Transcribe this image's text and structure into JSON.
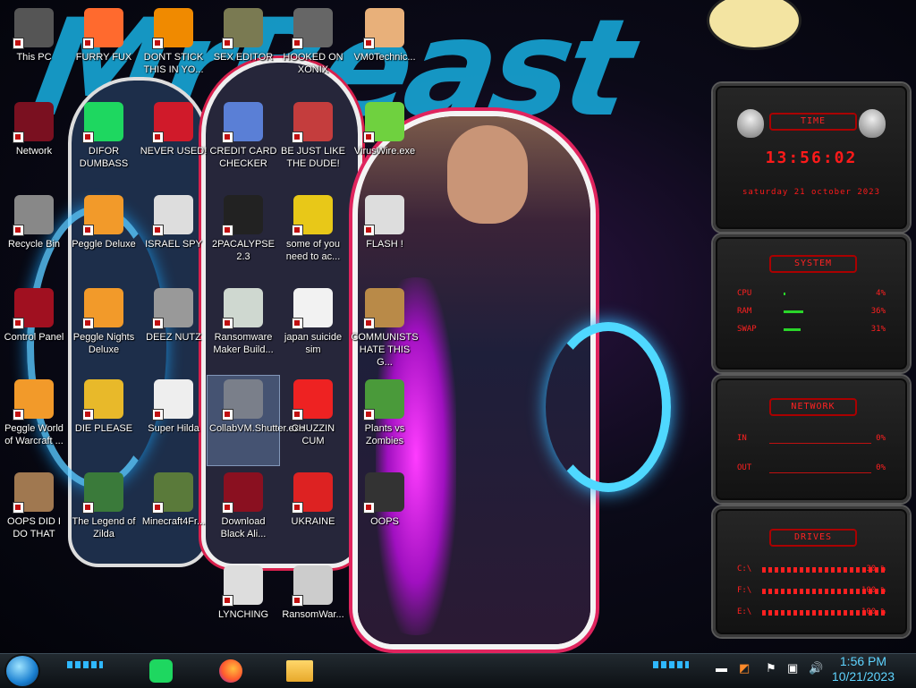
{
  "desktop": {
    "icons": [
      {
        "label": "This PC",
        "icon": "computer-icon"
      },
      {
        "label": "FURRY FUX",
        "icon": "firefox-icon"
      },
      {
        "label": "DONT STICK THIS IN YO...",
        "icon": "vlc-icon"
      },
      {
        "label": "SEX EDITOR",
        "icon": "hxd-icon"
      },
      {
        "label": "HOOKED ON XONIX",
        "icon": "xonix-icon"
      },
      {
        "label": "VM0Technic...",
        "icon": "doctor-icon"
      },
      {
        "label": "Network",
        "icon": "network-icon"
      },
      {
        "label": "DIFOR DUMBASS",
        "icon": "discord-icon"
      },
      {
        "label": "NEVER USED!",
        "icon": "dev-icon"
      },
      {
        "label": "CREDIT CARD CHECKER",
        "icon": "credit-card-icon"
      },
      {
        "label": "BE JUST LIKE THE DUDE!",
        "icon": "santa-icon"
      },
      {
        "label": "VirusWire.exe",
        "icon": "lime-icon"
      },
      {
        "label": "Recycle Bin",
        "icon": "recycle-bin-icon"
      },
      {
        "label": "Peggle Deluxe",
        "icon": "peggle-icon"
      },
      {
        "label": "ISRAEL SPY",
        "icon": "spy-icon"
      },
      {
        "label": "2PACALYPSE 2.3",
        "icon": "terminal-icon"
      },
      {
        "label": "some of you need to ac...",
        "icon": "beaver-icon"
      },
      {
        "label": "FLASH !",
        "icon": "flash-icon"
      },
      {
        "label": "Control Panel",
        "icon": "control-panel-icon"
      },
      {
        "label": "Peggle Nights Deluxe",
        "icon": "peggle-nights-icon"
      },
      {
        "label": "DEEZ NUTZ",
        "icon": "windows-stack-icon"
      },
      {
        "label": "Ransomware Maker Build...",
        "icon": "app-window-icon"
      },
      {
        "label": "japan suicide sim",
        "icon": "document-icon"
      },
      {
        "label": "COMMUNISTS HATE THIS G...",
        "icon": "money-bag-icon"
      },
      {
        "label": "Peggle World of Warcraft ...",
        "icon": "peggle-wow-icon"
      },
      {
        "label": "DIE PLEASE",
        "icon": "dreamweaver-icon"
      },
      {
        "label": "Super Hilda",
        "icon": "pixel-icon"
      },
      {
        "label": "CollabVM.Shutter.exe",
        "icon": "monitor-icon"
      },
      {
        "label": "CHUZZIN CUM",
        "icon": "chuzzle-icon"
      },
      {
        "label": "Plants vs Zombies",
        "icon": "plant-icon"
      },
      {
        "label": "OOPS DID I DO THAT",
        "icon": "portrait-icon"
      },
      {
        "label": "The Legend of Zilda",
        "icon": "zelda-icon"
      },
      {
        "label": "Minecraft4Fr...",
        "icon": "minecraft-icon"
      },
      {
        "label": "Download Black Ali...",
        "icon": "alien-icon"
      },
      {
        "label": "UKRAINE",
        "icon": "radiation-icon"
      },
      {
        "label": "OOPS",
        "icon": "oops-icon"
      },
      {
        "label": "LYNCHING",
        "icon": "rope-icon"
      },
      {
        "label": "RansomWar...",
        "icon": "skull-icon"
      }
    ],
    "collabvm_label": "CollabVM.Sh"
  },
  "widgets": {
    "time": {
      "title": "TIME",
      "time": "13:56:02",
      "date": "saturday 21 october 2023"
    },
    "system": {
      "title": "SYSTEM",
      "rows": [
        {
          "key": "CPU",
          "value": "4%",
          "level": 0.04
        },
        {
          "key": "RAM",
          "value": "36%",
          "level": 0.36
        },
        {
          "key": "SWAP",
          "value": "31%",
          "level": 0.31
        }
      ]
    },
    "network": {
      "title": "NETWORK",
      "rows": [
        {
          "key": "IN",
          "value": "0%"
        },
        {
          "key": "OUT",
          "value": "0%"
        }
      ]
    },
    "drives": {
      "title": "DRIVES",
      "rows": [
        {
          "key": "C:\\",
          "value": "30 %"
        },
        {
          "key": "F:\\",
          "value": "100 %"
        },
        {
          "key": "E:\\",
          "value": "100 %"
        }
      ]
    }
  },
  "taskbar": {
    "apps": [
      {
        "name": "spotify-app",
        "icon": "spotify-icon"
      },
      {
        "name": "firefox-app",
        "icon": "firefox-icon"
      },
      {
        "name": "explorer-app",
        "icon": "folder-icon"
      }
    ],
    "clock": {
      "time": "1:56 PM",
      "date": "10/21/2023"
    },
    "colors": {
      "accent": "#2fb8ff",
      "widget_text": "#ff2020"
    }
  }
}
